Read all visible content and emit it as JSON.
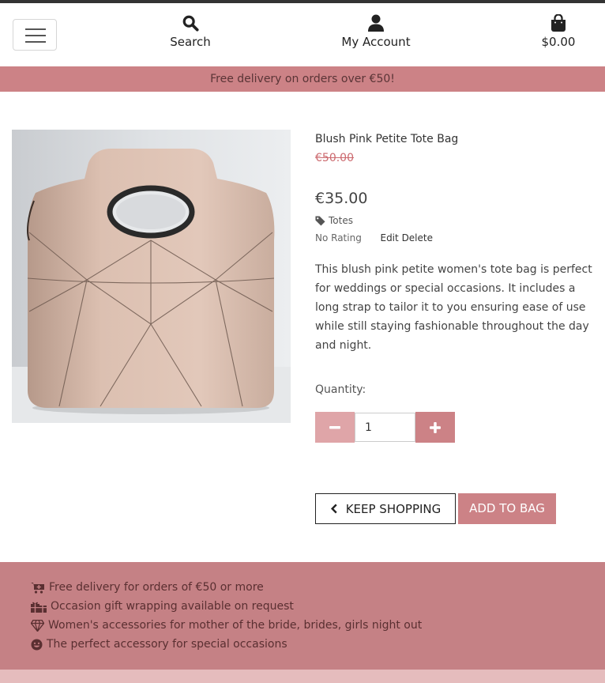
{
  "nav": {
    "search_label": "Search",
    "account_label": "My Account",
    "bag_total": "$0.00"
  },
  "promo_banner": "Free delivery on orders over €50!",
  "product": {
    "name": "Blush Pink Petite Tote Bag",
    "original_price": "€50.00",
    "price": "€35.00",
    "category": "Totes",
    "rating": "No Rating",
    "edit_label": "Edit",
    "delete_label": "Delete",
    "description": "This blush pink petite women's tote bag is perfect for weddings or special occasions. It includes a long strap to tailor it to you ensuring ease of use while still staying fashionable throughout the day and night.",
    "quantity_label": "Quantity:",
    "quantity_value": "1"
  },
  "actions": {
    "keep_shopping": "KEEP SHOPPING",
    "add_to_bag": "ADD TO BAG"
  },
  "footer": {
    "items": [
      {
        "icon": "cart-plus-icon",
        "highlight": "",
        "text": "Free delivery for orders of €50 or more"
      },
      {
        "icon": "gifts-icon",
        "highlight": "Occasion",
        "text": " gift wrapping available on request"
      },
      {
        "icon": "gem-icon",
        "highlight": "Women's accessories",
        "text": " for mother of the bride, brides, girls night out"
      },
      {
        "icon": "smile-icon",
        "highlight": "",
        "text": "The perfect accessory for special occasions"
      }
    ]
  },
  "colors": {
    "brand_pink": "#cc8286",
    "light_pink": "#dfa5a8",
    "sale_red": "#cc6a6f",
    "footer_bg": "#c58185"
  }
}
